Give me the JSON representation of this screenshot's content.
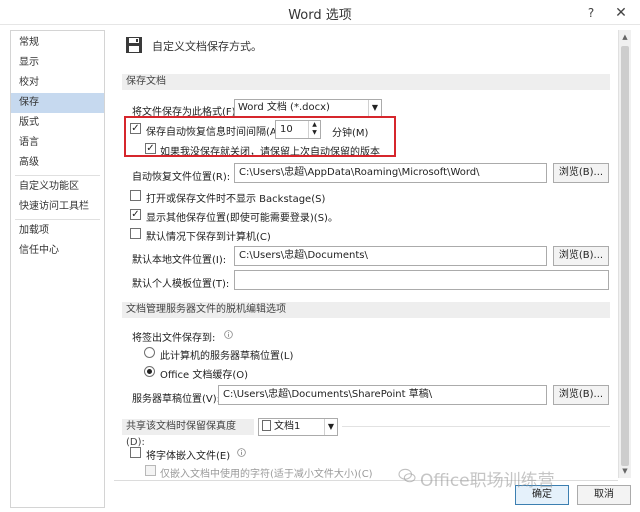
{
  "window": {
    "title": "Word 选项",
    "help_label": "?",
    "close_label": "✕"
  },
  "sidebar": {
    "items": [
      {
        "label": "常规"
      },
      {
        "label": "显示"
      },
      {
        "label": "校对"
      },
      {
        "label": "保存",
        "active": true
      },
      {
        "label": "版式"
      },
      {
        "label": "语言"
      },
      {
        "label": "高级"
      },
      {
        "label": "自定义功能区"
      },
      {
        "label": "快速访问工具栏"
      },
      {
        "label": "加载项"
      },
      {
        "label": "信任中心"
      }
    ]
  },
  "header": {
    "icon": "save-settings-icon",
    "text": "自定义文档保存方式。"
  },
  "save_docs": {
    "section_title": "保存文档",
    "format_label": "将文件保存为此格式(F):",
    "format_value": "Word 文档 (*.docx)",
    "autorecover_label": "保存自动恢复信息时间间隔(A)",
    "autorecover_checked": true,
    "autorecover_minutes": "10",
    "minutes_label": "分钟(M)",
    "keep_last_label": "如果我没保存就关闭，请保留上次自动保留的版本",
    "keep_last_checked": true,
    "autorecover_location_label": "自动恢复文件位置(R):",
    "autorecover_location_value": "C:\\Users\\忠超\\AppData\\Roaming\\Microsoft\\Word\\",
    "browse_label": "浏览(B)...",
    "no_backstage_label": "打开或保存文件时不显示 Backstage(S)",
    "no_backstage_checked": false,
    "show_additional_label": "显示其他保存位置(即使可能需要登录)(S)。",
    "show_additional_checked": true,
    "save_to_computer_label": "默认情况下保存到计算机(C)",
    "save_to_computer_checked": false,
    "local_location_label": "默认本地文件位置(I):",
    "local_location_value": "C:\\Users\\忠超\\Documents\\",
    "template_location_label": "默认个人模板位置(T):",
    "template_location_value": ""
  },
  "offline": {
    "section_title": "文档管理服务器文件的脱机编辑选项",
    "save_checkout_label": "将签出文件保存到:",
    "info_icon": "info-icon",
    "option_server_label": "此计算机的服务器草稿位置(L)",
    "option_cache_label": "Office 文档缓存(O)",
    "selected": "cache",
    "drafts_location_label": "服务器草稿位置(V):",
    "drafts_location_value": "C:\\Users\\忠超\\Documents\\SharePoint 草稿\\"
  },
  "fidelity": {
    "section_title": "共享该文档时保留保真度(D):",
    "doc_value": "文档1",
    "embed_fonts_label": "将字体嵌入文件(E)",
    "embed_fonts_checked": false,
    "embed_used_only_label": "仅嵌入文档中使用的字符(适于减小文件大小)(C)"
  },
  "footer": {
    "ok_label": "确定",
    "cancel_label": "取消"
  },
  "watermark": {
    "text": "Office职场训练营"
  },
  "colors": {
    "highlight": "#d6262c",
    "active_nav": "#c6d9ef"
  }
}
